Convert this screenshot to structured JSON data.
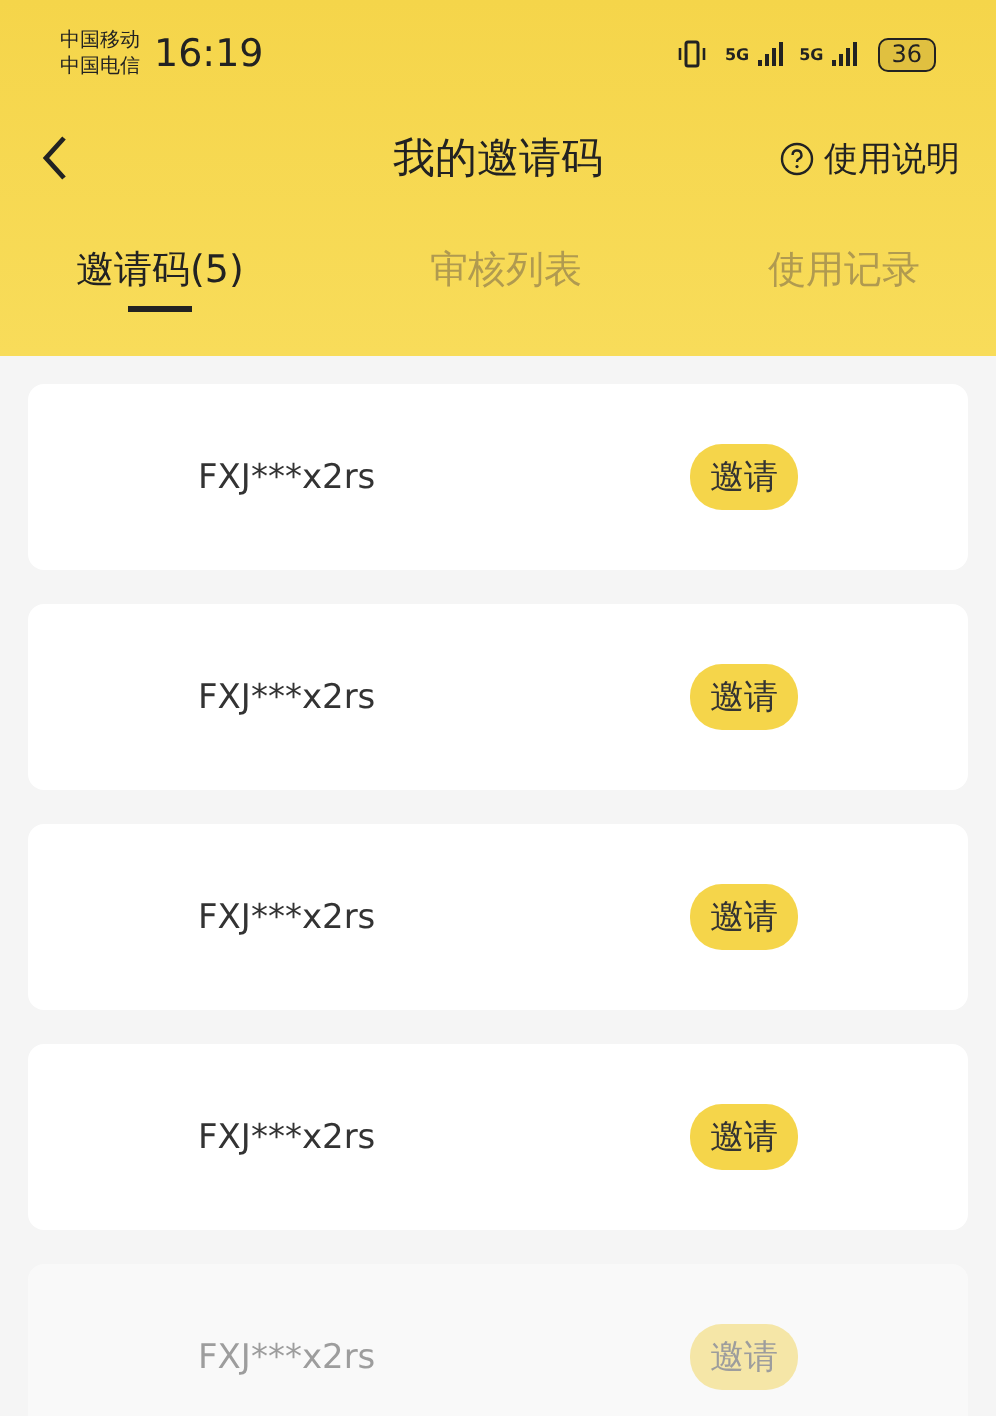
{
  "status_bar": {
    "carriers": [
      "中国移动",
      "中国电信"
    ],
    "time": "16:19",
    "network_1": "5G",
    "network_2": "5G",
    "battery": "36"
  },
  "nav": {
    "title": "我的邀请码",
    "help": "使用说明"
  },
  "tabs": [
    {
      "label": "邀请码(5)",
      "selected": true
    },
    {
      "label": "审核列表",
      "selected": false
    },
    {
      "label": "使用记录",
      "selected": false
    }
  ],
  "codes": [
    {
      "code": "FXJ***x2rs",
      "action": "邀请",
      "faded": false
    },
    {
      "code": "FXJ***x2rs",
      "action": "邀请",
      "faded": false
    },
    {
      "code": "FXJ***x2rs",
      "action": "邀请",
      "faded": false
    },
    {
      "code": "FXJ***x2rs",
      "action": "邀请",
      "faded": false
    },
    {
      "code": "FXJ***x2rs",
      "action": "邀请",
      "faded": true
    }
  ]
}
